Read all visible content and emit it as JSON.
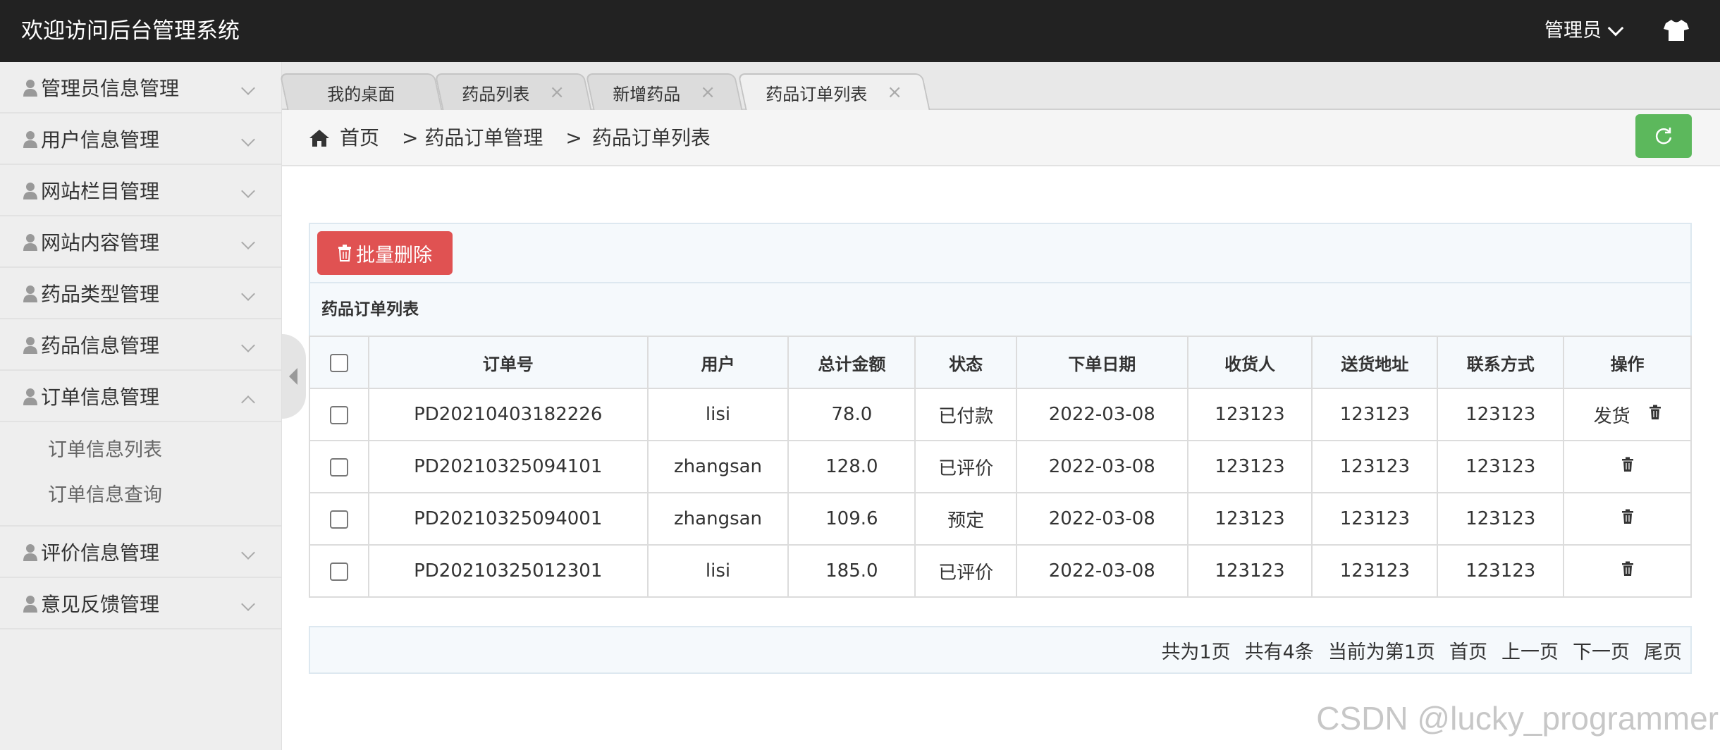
{
  "header": {
    "title": "欢迎访问后台管理系统",
    "user_label": "管理员"
  },
  "sidebar": {
    "items": [
      {
        "label": "管理员信息管理",
        "expanded": false
      },
      {
        "label": "用户信息管理",
        "expanded": false
      },
      {
        "label": "网站栏目管理",
        "expanded": false
      },
      {
        "label": "网站内容管理",
        "expanded": false
      },
      {
        "label": "药品类型管理",
        "expanded": false
      },
      {
        "label": "药品信息管理",
        "expanded": false
      },
      {
        "label": "订单信息管理",
        "expanded": true,
        "children": [
          "订单信息列表",
          "订单信息查询"
        ]
      },
      {
        "label": "评价信息管理",
        "expanded": false
      },
      {
        "label": "意见反馈管理",
        "expanded": false
      }
    ]
  },
  "tabs": [
    {
      "label": "我的桌面",
      "closable": false
    },
    {
      "label": "药品列表",
      "closable": true
    },
    {
      "label": "新增药品",
      "closable": true
    },
    {
      "label": "药品订单列表",
      "closable": true,
      "active": true
    }
  ],
  "tab_close_glyph": "×",
  "breadcrumb": {
    "home": "首页",
    "level1": "> 药品订单管理",
    "level2": ">",
    "level3": "药品订单列表"
  },
  "toolbar": {
    "batch_delete_label": "批量删除"
  },
  "table": {
    "title": "药品订单列表",
    "columns": [
      "订单号",
      "用户",
      "总计金额",
      "状态",
      "下单日期",
      "收货人",
      "送货地址",
      "联系方式",
      "操作"
    ],
    "rows": [
      {
        "order_no": "PD20210403182226",
        "user": "lisi",
        "total": "78.0",
        "status": "已付款",
        "date": "2022-03-08",
        "receiver": "123123",
        "address": "123123",
        "contact": "123123",
        "action": "发货"
      },
      {
        "order_no": "PD20210325094101",
        "user": "zhangsan",
        "total": "128.0",
        "status": "已评价",
        "date": "2022-03-08",
        "receiver": "123123",
        "address": "123123",
        "contact": "123123",
        "action": ""
      },
      {
        "order_no": "PD20210325094001",
        "user": "zhangsan",
        "total": "109.6",
        "status": "预定",
        "date": "2022-03-08",
        "receiver": "123123",
        "address": "123123",
        "contact": "123123",
        "action": ""
      },
      {
        "order_no": "PD20210325012301",
        "user": "lisi",
        "total": "185.0",
        "status": "已评价",
        "date": "2022-03-08",
        "receiver": "123123",
        "address": "123123",
        "contact": "123123",
        "action": ""
      }
    ]
  },
  "pager": {
    "total_pages": "共为1页",
    "total_items": "共有4条",
    "current": "当前为第1页",
    "first": "首页",
    "prev": "上一页",
    "next": "下一页",
    "last": "尾页"
  },
  "watermark": "CSDN @lucky_programmer",
  "colors": {
    "header_bg": "#222222",
    "refresh": "#5cb85c",
    "delete": "#e05252"
  }
}
